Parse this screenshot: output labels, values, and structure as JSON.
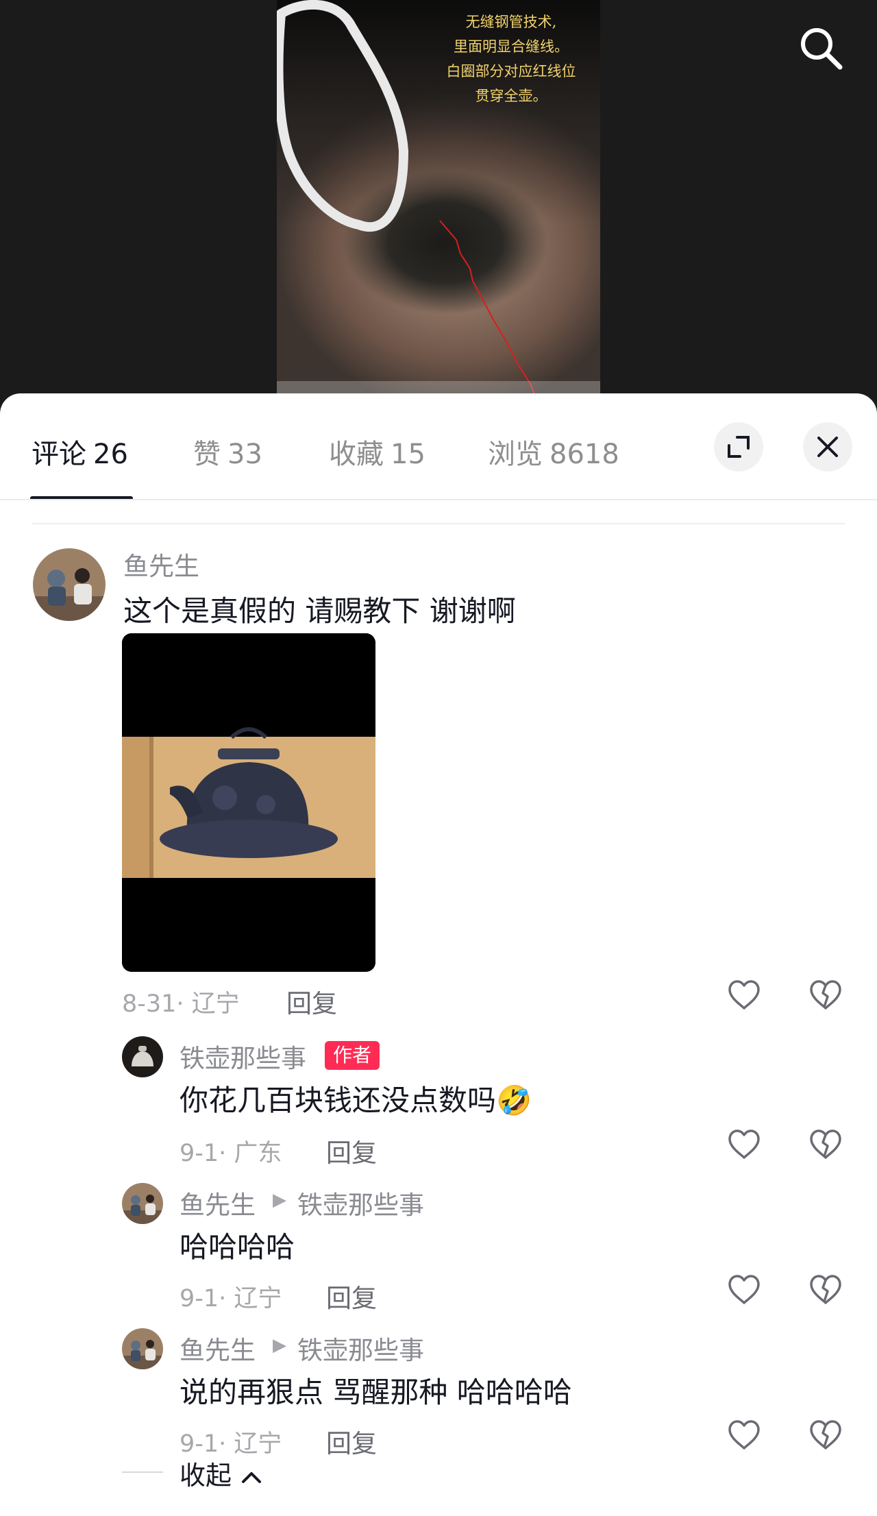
{
  "video": {
    "overlay_lines": [
      "无缝钢管技术,",
      "里面明显合缝线。",
      "白圈部分对应红线位",
      "贯穿全壶。"
    ]
  },
  "tabs": [
    {
      "label": "评论",
      "count": "26",
      "active": true
    },
    {
      "label": "赞",
      "count": "33",
      "active": false
    },
    {
      "label": "收藏",
      "count": "15",
      "active": false
    },
    {
      "label": "浏览",
      "count": "8618",
      "active": false
    }
  ],
  "comment": {
    "author": "鱼先生",
    "text": "这个是真假的 请赐教下 谢谢啊",
    "date_location": "8-31· 辽宁",
    "reply_label": "回复"
  },
  "replies": [
    {
      "author": "铁壶那些事",
      "badge": "作者",
      "text": "你花几百块钱还没点数吗🤣",
      "date_location": "9-1· 广东",
      "reply_label": "回复"
    },
    {
      "author": "鱼先生",
      "reply_to": "铁壶那些事",
      "text": "哈哈哈哈",
      "date_location": "9-1· 辽宁",
      "reply_label": "回复"
    },
    {
      "author": "鱼先生",
      "reply_to": "铁壶那些事",
      "text": "说的再狠点 骂醒那种 哈哈哈哈",
      "date_location": "9-1· 辽宁",
      "reply_label": "回复"
    }
  ],
  "collapse_label": "收起",
  "colors": {
    "author_badge": "#fe2c55",
    "overlay_text": "#f1d36b",
    "text_primary": "#161823",
    "text_secondary": "#8a8b91"
  },
  "icons": {
    "search": "search-icon",
    "expand": "expand-icon",
    "close": "close-icon",
    "like": "heart-icon",
    "dislike": "broken-heart-icon",
    "collapse": "chevron-up-icon"
  }
}
